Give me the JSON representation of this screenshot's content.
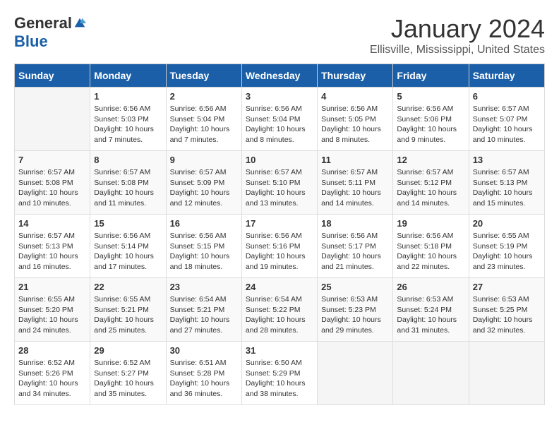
{
  "header": {
    "logo_general": "General",
    "logo_blue": "Blue",
    "month": "January 2024",
    "location": "Ellisville, Mississippi, United States"
  },
  "days_of_week": [
    "Sunday",
    "Monday",
    "Tuesday",
    "Wednesday",
    "Thursday",
    "Friday",
    "Saturday"
  ],
  "weeks": [
    [
      {
        "day": "",
        "sunrise": "",
        "sunset": "",
        "daylight": ""
      },
      {
        "day": "1",
        "sunrise": "Sunrise: 6:56 AM",
        "sunset": "Sunset: 5:03 PM",
        "daylight": "Daylight: 10 hours and 7 minutes."
      },
      {
        "day": "2",
        "sunrise": "Sunrise: 6:56 AM",
        "sunset": "Sunset: 5:04 PM",
        "daylight": "Daylight: 10 hours and 7 minutes."
      },
      {
        "day": "3",
        "sunrise": "Sunrise: 6:56 AM",
        "sunset": "Sunset: 5:04 PM",
        "daylight": "Daylight: 10 hours and 8 minutes."
      },
      {
        "day": "4",
        "sunrise": "Sunrise: 6:56 AM",
        "sunset": "Sunset: 5:05 PM",
        "daylight": "Daylight: 10 hours and 8 minutes."
      },
      {
        "day": "5",
        "sunrise": "Sunrise: 6:56 AM",
        "sunset": "Sunset: 5:06 PM",
        "daylight": "Daylight: 10 hours and 9 minutes."
      },
      {
        "day": "6",
        "sunrise": "Sunrise: 6:57 AM",
        "sunset": "Sunset: 5:07 PM",
        "daylight": "Daylight: 10 hours and 10 minutes."
      }
    ],
    [
      {
        "day": "7",
        "sunrise": "Sunrise: 6:57 AM",
        "sunset": "Sunset: 5:08 PM",
        "daylight": "Daylight: 10 hours and 10 minutes."
      },
      {
        "day": "8",
        "sunrise": "Sunrise: 6:57 AM",
        "sunset": "Sunset: 5:08 PM",
        "daylight": "Daylight: 10 hours and 11 minutes."
      },
      {
        "day": "9",
        "sunrise": "Sunrise: 6:57 AM",
        "sunset": "Sunset: 5:09 PM",
        "daylight": "Daylight: 10 hours and 12 minutes."
      },
      {
        "day": "10",
        "sunrise": "Sunrise: 6:57 AM",
        "sunset": "Sunset: 5:10 PM",
        "daylight": "Daylight: 10 hours and 13 minutes."
      },
      {
        "day": "11",
        "sunrise": "Sunrise: 6:57 AM",
        "sunset": "Sunset: 5:11 PM",
        "daylight": "Daylight: 10 hours and 14 minutes."
      },
      {
        "day": "12",
        "sunrise": "Sunrise: 6:57 AM",
        "sunset": "Sunset: 5:12 PM",
        "daylight": "Daylight: 10 hours and 14 minutes."
      },
      {
        "day": "13",
        "sunrise": "Sunrise: 6:57 AM",
        "sunset": "Sunset: 5:13 PM",
        "daylight": "Daylight: 10 hours and 15 minutes."
      }
    ],
    [
      {
        "day": "14",
        "sunrise": "Sunrise: 6:57 AM",
        "sunset": "Sunset: 5:13 PM",
        "daylight": "Daylight: 10 hours and 16 minutes."
      },
      {
        "day": "15",
        "sunrise": "Sunrise: 6:56 AM",
        "sunset": "Sunset: 5:14 PM",
        "daylight": "Daylight: 10 hours and 17 minutes."
      },
      {
        "day": "16",
        "sunrise": "Sunrise: 6:56 AM",
        "sunset": "Sunset: 5:15 PM",
        "daylight": "Daylight: 10 hours and 18 minutes."
      },
      {
        "day": "17",
        "sunrise": "Sunrise: 6:56 AM",
        "sunset": "Sunset: 5:16 PM",
        "daylight": "Daylight: 10 hours and 19 minutes."
      },
      {
        "day": "18",
        "sunrise": "Sunrise: 6:56 AM",
        "sunset": "Sunset: 5:17 PM",
        "daylight": "Daylight: 10 hours and 21 minutes."
      },
      {
        "day": "19",
        "sunrise": "Sunrise: 6:56 AM",
        "sunset": "Sunset: 5:18 PM",
        "daylight": "Daylight: 10 hours and 22 minutes."
      },
      {
        "day": "20",
        "sunrise": "Sunrise: 6:55 AM",
        "sunset": "Sunset: 5:19 PM",
        "daylight": "Daylight: 10 hours and 23 minutes."
      }
    ],
    [
      {
        "day": "21",
        "sunrise": "Sunrise: 6:55 AM",
        "sunset": "Sunset: 5:20 PM",
        "daylight": "Daylight: 10 hours and 24 minutes."
      },
      {
        "day": "22",
        "sunrise": "Sunrise: 6:55 AM",
        "sunset": "Sunset: 5:21 PM",
        "daylight": "Daylight: 10 hours and 25 minutes."
      },
      {
        "day": "23",
        "sunrise": "Sunrise: 6:54 AM",
        "sunset": "Sunset: 5:21 PM",
        "daylight": "Daylight: 10 hours and 27 minutes."
      },
      {
        "day": "24",
        "sunrise": "Sunrise: 6:54 AM",
        "sunset": "Sunset: 5:22 PM",
        "daylight": "Daylight: 10 hours and 28 minutes."
      },
      {
        "day": "25",
        "sunrise": "Sunrise: 6:53 AM",
        "sunset": "Sunset: 5:23 PM",
        "daylight": "Daylight: 10 hours and 29 minutes."
      },
      {
        "day": "26",
        "sunrise": "Sunrise: 6:53 AM",
        "sunset": "Sunset: 5:24 PM",
        "daylight": "Daylight: 10 hours and 31 minutes."
      },
      {
        "day": "27",
        "sunrise": "Sunrise: 6:53 AM",
        "sunset": "Sunset: 5:25 PM",
        "daylight": "Daylight: 10 hours and 32 minutes."
      }
    ],
    [
      {
        "day": "28",
        "sunrise": "Sunrise: 6:52 AM",
        "sunset": "Sunset: 5:26 PM",
        "daylight": "Daylight: 10 hours and 34 minutes."
      },
      {
        "day": "29",
        "sunrise": "Sunrise: 6:52 AM",
        "sunset": "Sunset: 5:27 PM",
        "daylight": "Daylight: 10 hours and 35 minutes."
      },
      {
        "day": "30",
        "sunrise": "Sunrise: 6:51 AM",
        "sunset": "Sunset: 5:28 PM",
        "daylight": "Daylight: 10 hours and 36 minutes."
      },
      {
        "day": "31",
        "sunrise": "Sunrise: 6:50 AM",
        "sunset": "Sunset: 5:29 PM",
        "daylight": "Daylight: 10 hours and 38 minutes."
      },
      {
        "day": "",
        "sunrise": "",
        "sunset": "",
        "daylight": ""
      },
      {
        "day": "",
        "sunrise": "",
        "sunset": "",
        "daylight": ""
      },
      {
        "day": "",
        "sunrise": "",
        "sunset": "",
        "daylight": ""
      }
    ]
  ]
}
